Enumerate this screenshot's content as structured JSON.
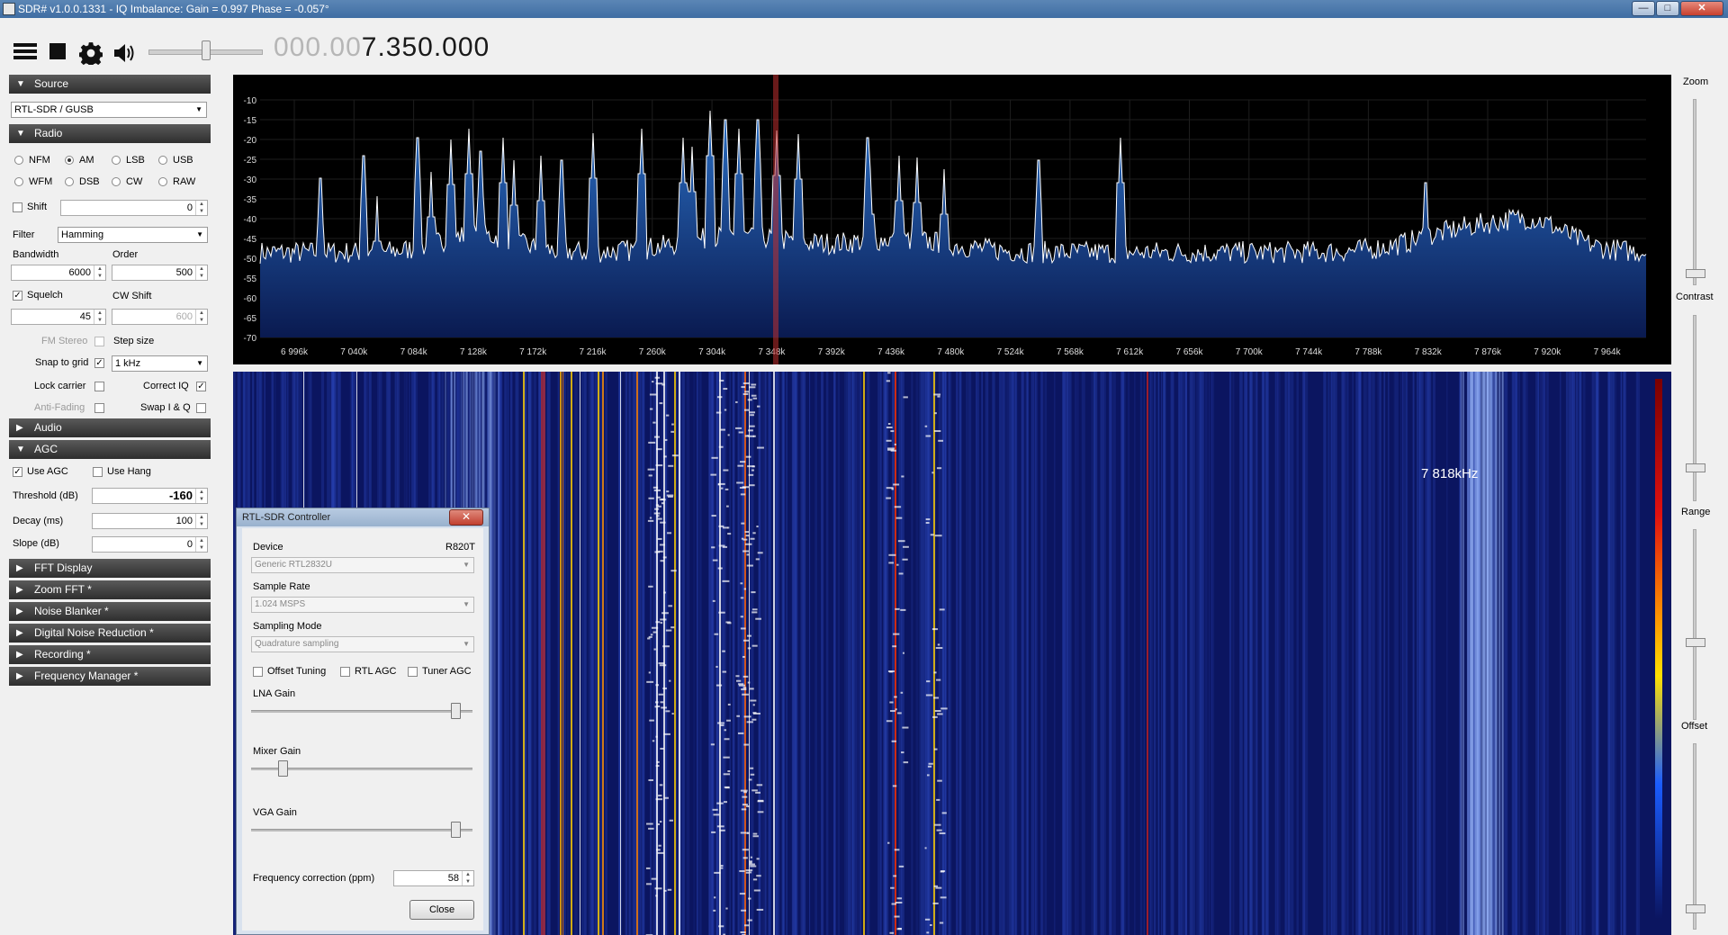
{
  "window": {
    "title": "SDR# v1.0.0.1331 - IQ Imbalance: Gain = 0.997 Phase = -0.057°",
    "minimize_label": "—",
    "maximize_label": "□",
    "close_label": "✕"
  },
  "toolbar": {
    "menu_icon": "hamburger-icon",
    "stop_icon": "stop-icon",
    "settings_icon": "gear-icon",
    "audio_icon": "speaker-icon",
    "frequency_dim": "000.00",
    "frequency_main": "7.350.000"
  },
  "source": {
    "header": "Source",
    "device": "RTL-SDR / GUSB"
  },
  "radio": {
    "header": "Radio",
    "modes": [
      {
        "label": "NFM",
        "selected": false
      },
      {
        "label": "AM",
        "selected": true
      },
      {
        "label": "LSB",
        "selected": false
      },
      {
        "label": "USB",
        "selected": false
      },
      {
        "label": "WFM",
        "selected": false
      },
      {
        "label": "DSB",
        "selected": false
      },
      {
        "label": "CW",
        "selected": false
      },
      {
        "label": "RAW",
        "selected": false
      }
    ],
    "shift_label": "Shift",
    "shift_value": "0",
    "filter_label": "Filter",
    "filter_value": "Hamming",
    "bandwidth_label": "Bandwidth",
    "bandwidth_value": "6000",
    "order_label": "Order",
    "order_value": "500",
    "squelch_label": "Squelch",
    "squelch_value": "45",
    "cw_shift_label": "CW Shift",
    "cw_shift_value": "600",
    "fm_stereo_label": "FM Stereo",
    "step_size_label": "Step size",
    "snap_label": "Snap to grid",
    "step_value": "1 kHz",
    "lock_carrier_label": "Lock carrier",
    "correct_iq_label": "Correct IQ",
    "anti_fading_label": "Anti-Fading",
    "swap_iq_label": "Swap I & Q"
  },
  "audio": {
    "header": "Audio"
  },
  "agc": {
    "header": "AGC",
    "use_agc_label": "Use AGC",
    "use_hang_label": "Use Hang",
    "threshold_label": "Threshold (dB)",
    "threshold_value": "-160",
    "decay_label": "Decay (ms)",
    "decay_value": "100",
    "slope_label": "Slope (dB)",
    "slope_value": "0"
  },
  "plugins": [
    "FFT Display",
    "Zoom FFT *",
    "Noise Blanker *",
    "Digital Noise Reduction *",
    "Recording *",
    "Frequency Manager *"
  ],
  "spectrum": {
    "y_ticks": [
      "-10",
      "-15",
      "-20",
      "-25",
      "-30",
      "-35",
      "-40",
      "-45",
      "-50",
      "-55",
      "-60",
      "-65",
      "-70"
    ],
    "x_ticks": [
      "6 996k",
      "7 040k",
      "7 084k",
      "7 128k",
      "7 172k",
      "7 216k",
      "7 260k",
      "7 304k",
      "7 348k",
      "7 392k",
      "7 436k",
      "7 480k",
      "7 524k",
      "7 568k",
      "7 612k",
      "7 656k",
      "7 700k",
      "7 744k",
      "7 788k",
      "7 832k",
      "7 876k",
      "7 920k",
      "7 964k"
    ],
    "trace_color": "#ffffff",
    "fill_color": "#2a6fc4",
    "tuner_color": "#c03030"
  },
  "waterfall": {
    "cursor_label": "7 818kHz"
  },
  "right_controls": {
    "zoom_label": "Zoom",
    "contrast_label": "Contrast",
    "range_label": "Range",
    "offset_label": "Offset"
  },
  "dialog": {
    "title": "RTL-SDR Controller",
    "close_x": "✕",
    "device_label": "Device",
    "tuner_type": "R820T",
    "device_value": "Generic RTL2832U",
    "sample_rate_label": "Sample Rate",
    "sample_rate_value": "1.024 MSPS",
    "sampling_mode_label": "Sampling Mode",
    "sampling_mode_value": "Quadrature sampling",
    "offset_tuning_label": "Offset Tuning",
    "rtl_agc_label": "RTL AGC",
    "tuner_agc_label": "Tuner AGC",
    "lna_gain_label": "LNA Gain",
    "mixer_gain_label": "Mixer Gain",
    "vga_gain_label": "VGA Gain",
    "freq_corr_label": "Frequency correction (ppm)",
    "freq_corr_value": "58",
    "close_button": "Close"
  }
}
